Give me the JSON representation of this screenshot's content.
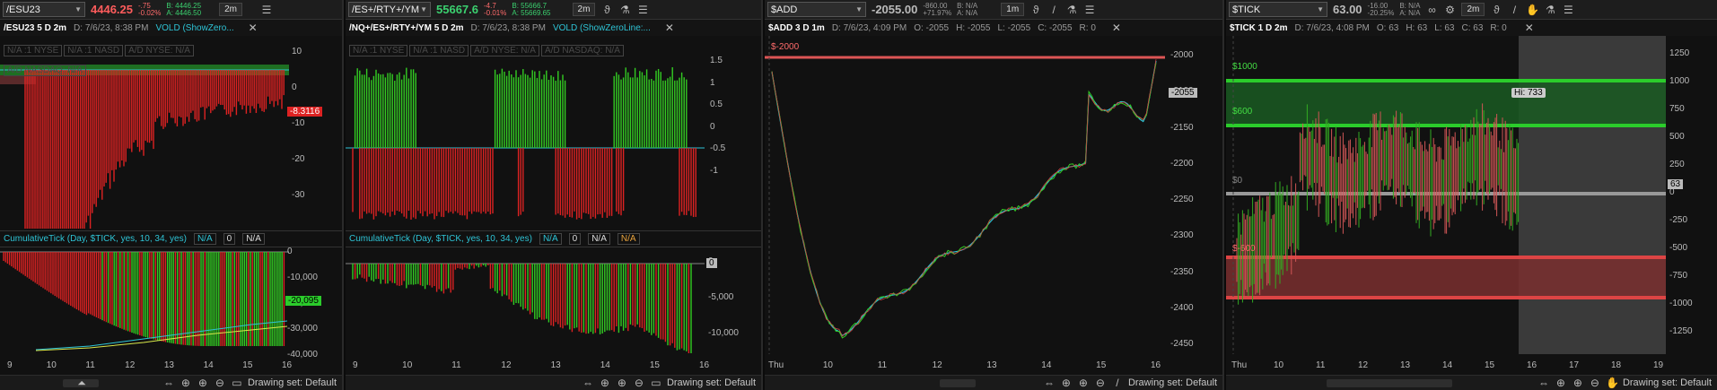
{
  "colors": {
    "up": "#33cc22",
    "down": "#dd2222",
    "accent_cyan": "#2ec4d6",
    "band_green": "#1e8f2c",
    "band_red": "#b53a3a",
    "zero_line": "#888888"
  },
  "panel1": {
    "symbol": "/ESU23",
    "price": "4446.25",
    "change": "-.75",
    "change_pct": "-0.02%",
    "bid": "B: 4446.25",
    "ask": "A: 4446.50",
    "timeframe": "2m",
    "title": "/ESU23 5 D 2m",
    "date": "D: 7/6/23, 8:38 PM",
    "study": "VOLD (ShowZero...",
    "overlay_labels": [
      "N/A :1 NYSE",
      "N/A :1 NASD",
      "A/D NYSE: N/A",
      "A/D NASDAQ: N/A"
    ],
    "upper_axis": [
      "10",
      "0",
      "-10",
      "-20",
      "-30"
    ],
    "upper_flag": "-8.3116",
    "lower_study": "CumulativeTick (Day, $TICK, yes, 10, 34, yes)",
    "lower_na1": "N/A",
    "lower_zero": "0",
    "lower_na2": "N/A",
    "lower_axis": [
      "0",
      "-10,000",
      "-20,000",
      "-30,000",
      "-40,000"
    ],
    "lower_flag": "-20,095",
    "x_labels": [
      "9",
      "10",
      "11",
      "12",
      "13",
      "14",
      "15",
      "16"
    ],
    "drawing_set": "Drawing set: Default"
  },
  "panel2": {
    "symbol": "/ES+/RTY+/YM",
    "price": "55667.6",
    "change": "-4.7",
    "change_pct": "-0.01%",
    "bid": "B: 55666.7",
    "ask": "A: 55669.65",
    "timeframe": "2m",
    "title": "/NQ+/ES+/RTY+/YM 5 D 2m",
    "date": "D: 7/6/23, 8:38 PM",
    "study": "VOLD (ShowZeroLine:...",
    "overlay_labels": [
      "N/A :1 NYSE",
      "N/A :1 NASD",
      "A/D NYSE: N/A",
      "A/D NASDAQ: N/A"
    ],
    "upper_axis": [
      "1.5",
      "1",
      "0.5",
      "0",
      "-0.5",
      "-1"
    ],
    "lower_study": "CumulativeTick (Day, $TICK, yes, 10, 34, yes)",
    "lower_na1": "N/A",
    "lower_zero": "0",
    "lower_na2": "N/A",
    "lower_na3": "N/A",
    "lower_axis": [
      "0",
      "-5,000",
      "-10,000"
    ],
    "lower_flag": "0",
    "x_labels": [
      "9",
      "10",
      "11",
      "12",
      "13",
      "14",
      "15",
      "16"
    ],
    "drawing_set": "Drawing set: Default"
  },
  "panel3": {
    "symbol": "$ADD",
    "price": "-2055.00",
    "change": "-860.00",
    "change_pct": "+71.97%",
    "bid": "B: N/A",
    "ask": "A: N/A",
    "timeframe": "1m",
    "title": "$ADD 3 D 1m",
    "date": "D: 7/6/23, 4:09 PM",
    "ohlc": [
      "O: -2055",
      "H: -2055",
      "L: -2055",
      "C: -2055",
      "R: 0"
    ],
    "level_label": "$-2000",
    "axis": [
      "-2000",
      "-2100",
      "-2150",
      "-2200",
      "-2250",
      "-2300",
      "-2350",
      "-2400",
      "-2450"
    ],
    "flag": "-2055",
    "x_labels": [
      "Thu",
      "10",
      "11",
      "12",
      "13",
      "14",
      "15",
      "16"
    ],
    "drawing_set": "Drawing set: Default"
  },
  "panel4": {
    "symbol": "$TICK",
    "price": "63.00",
    "change": "-16.00",
    "change_pct": "-20.25%",
    "bid": "B: N/A",
    "ask": "A: N/A",
    "timeframe": "2m",
    "title": "$TICK 1 D 2m",
    "date": "D: 7/6/23, 4:08 PM",
    "ohlc": [
      "O: 63",
      "H: 63",
      "L: 63",
      "C: 63",
      "R: 0"
    ],
    "levels": [
      "$1000",
      "$600",
      "$0",
      "$-600"
    ],
    "hi_label": "Hi: 733",
    "axis": [
      "1250",
      "1000",
      "750",
      "500",
      "250",
      "0",
      "-250",
      "-500",
      "-750",
      "-1000",
      "-1250"
    ],
    "flag": "63",
    "x_labels": [
      "Thu",
      "10",
      "11",
      "12",
      "13",
      "14",
      "15",
      "16",
      "17",
      "18",
      "19"
    ],
    "drawing_set": "Drawing set: Default"
  }
}
